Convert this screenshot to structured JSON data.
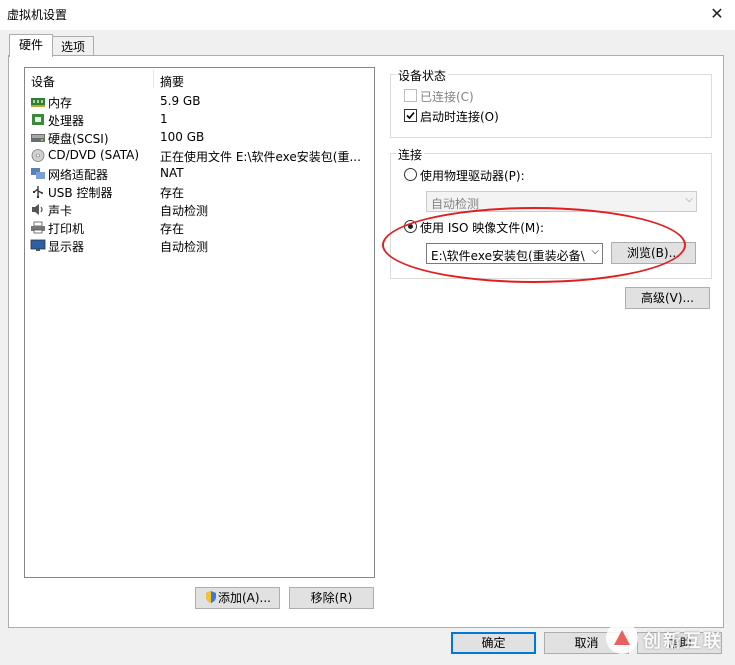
{
  "window": {
    "title": "虚拟机设置"
  },
  "tabs": [
    {
      "label": "硬件"
    },
    {
      "label": "选项"
    }
  ],
  "list": {
    "headers": {
      "device": "设备",
      "summary": "摘要"
    },
    "rows": [
      {
        "name": "内存",
        "summary": "5.9 GB",
        "icon": "memory-icon"
      },
      {
        "name": "处理器",
        "summary": "1",
        "icon": "processor-icon"
      },
      {
        "name": "硬盘(SCSI)",
        "summary": "100 GB",
        "icon": "hard-disk-icon"
      },
      {
        "name": "CD/DVD (SATA)",
        "summary": "正在使用文件 E:\\软件exe安装包(重...",
        "icon": "cd-dvd-icon"
      },
      {
        "name": "网络适配器",
        "summary": "NAT",
        "icon": "network-adapter-icon"
      },
      {
        "name": "USB 控制器",
        "summary": "存在",
        "icon": "usb-icon"
      },
      {
        "name": "声卡",
        "summary": "自动检测",
        "icon": "sound-card-icon"
      },
      {
        "name": "打印机",
        "summary": "存在",
        "icon": "printer-icon"
      },
      {
        "name": "显示器",
        "summary": "自动检测",
        "icon": "display-icon"
      }
    ]
  },
  "list_buttons": {
    "add": "添加(A)...",
    "remove": "移除(R)"
  },
  "device_status": {
    "label": "设备状态",
    "connected": "已连接(C)",
    "connect_on_power": "启动时连接(O)"
  },
  "connection": {
    "label": "连接",
    "physical": "使用物理驱动器(P):",
    "physical_value": "自动检测",
    "iso": "使用 ISO 映像文件(M):",
    "iso_value": "E:\\软件exe安装包(重装必备\\",
    "browse": "浏览(B)..."
  },
  "advanced": "高级(V)...",
  "footer": {
    "ok": "确定",
    "cancel": "取消",
    "help": "帮助"
  },
  "watermark": {
    "text": "创新互联"
  },
  "colors": {
    "accent": "#0078d7",
    "highlight_ellipse": "#e02020"
  }
}
